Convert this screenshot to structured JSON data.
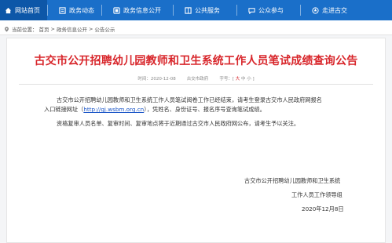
{
  "nav": {
    "items": [
      {
        "label": "网站首页",
        "icon": "home-icon",
        "active": true
      },
      {
        "label": "政务动态",
        "icon": "news-icon",
        "active": false
      },
      {
        "label": "政务信息公开",
        "icon": "document-icon",
        "active": false
      },
      {
        "label": "公共服务",
        "icon": "service-icon",
        "active": false
      },
      {
        "label": "公众参与",
        "icon": "chat-icon",
        "active": false
      },
      {
        "label": "走进古交",
        "icon": "location-icon",
        "active": false
      }
    ]
  },
  "breadcrumb": {
    "prefix": "当前位置：",
    "items": [
      "首页",
      "政务信息公开",
      "公告公示"
    ],
    "separator": ">"
  },
  "article": {
    "title": "古交市公开招聘幼儿园教师和卫生系统工作人员笔试成绩查询公告",
    "meta": {
      "time": "时间：2020-12-08",
      "source": "古交市政府",
      "font_label": "字号：[",
      "font_big": "大",
      "font_mid": "中",
      "font_small": "小",
      "font_end": "]"
    },
    "para1_line1": "古交市公开招聘幼儿园教师和卫生系统工作人员笔试阅卷工作已经结束，请考生登录古交市人民政府网报名",
    "para1_line2_a": "入口链接网址（",
    "para1_link": "http://gj.wsbm.org.cn",
    "para1_line2_b": "），凭姓名、身份证号、报名序号查询笔试成绩。",
    "para2": "资格复审人员名单、复审时间、复审地点将于近期通过古交市人民政府网公布，请考生予以关注。",
    "signature": {
      "org1": "古交市公开招聘幼儿园教师和卫生系统",
      "org2": "工作人员工作领导组",
      "date": "2020年12月8日"
    }
  },
  "colors": {
    "nav_bg": "#1a6fc9",
    "nav_active": "#0d57a8",
    "title_red": "#d8262b",
    "link_blue": "#1a55c7"
  }
}
